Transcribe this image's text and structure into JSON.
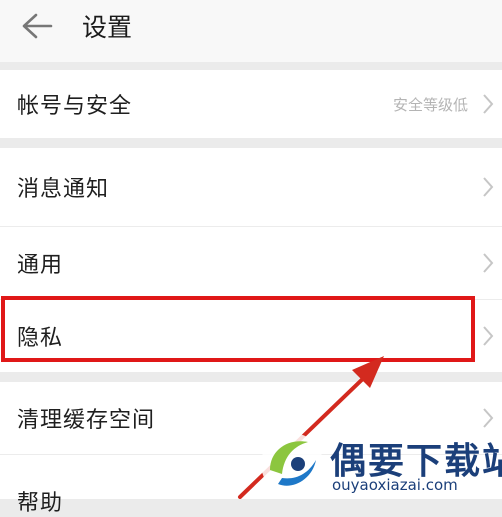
{
  "header": {
    "title": "设置",
    "back_icon": "arrow-left-icon"
  },
  "groups": [
    {
      "items": [
        {
          "label": "帐号与安全",
          "value": "安全等级低"
        }
      ]
    },
    {
      "items": [
        {
          "label": "消息通知"
        },
        {
          "label": "通用"
        },
        {
          "label": "隐私"
        }
      ]
    },
    {
      "items": [
        {
          "label": "清理缓存空间"
        },
        {
          "label": "帮助"
        }
      ]
    }
  ],
  "annotation": {
    "highlight_color": "#e01818",
    "arrow_color": "#d32a1f"
  },
  "watermark": {
    "name": "偶要下载站",
    "domain": "ouyaoxiazai.com"
  }
}
